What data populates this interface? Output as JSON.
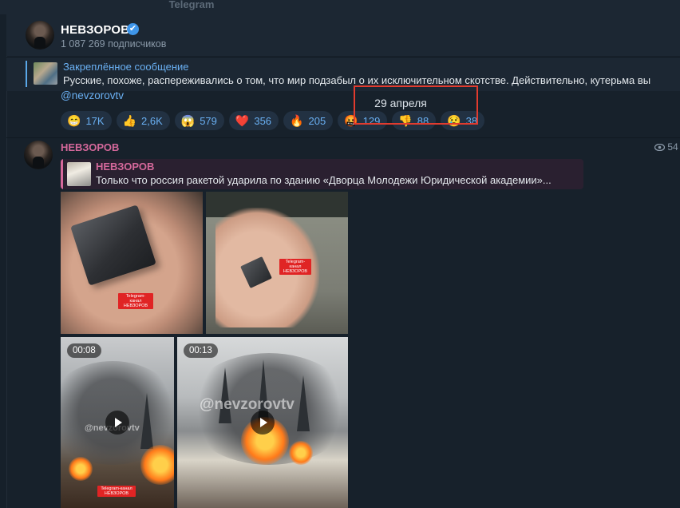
{
  "window": {
    "title": "Telegram"
  },
  "channel": {
    "name": "НЕВЗОРОВ",
    "verified_icon": "verified-check-icon",
    "subscribers": "1 087 269 подписчиков"
  },
  "pinned": {
    "title": "Закреплённое сообщение",
    "text": "Русские, похоже, распереживались о том, что мир подзабыл о их исключительном скотстве.  Действительно, кутерьма вы"
  },
  "prev_message": {
    "link": "@nevzorovtv",
    "reactions": [
      {
        "emoji": "😁",
        "icon": "grin-emoji-icon",
        "count": "17K"
      },
      {
        "emoji": "👍",
        "icon": "thumbs-up-emoji-icon",
        "count": "2,6K"
      },
      {
        "emoji": "😱",
        "icon": "scream-emoji-icon",
        "count": "579"
      },
      {
        "emoji": "❤️",
        "icon": "heart-emoji-icon",
        "count": "356"
      },
      {
        "emoji": "🔥",
        "icon": "fire-emoji-icon",
        "count": "205"
      },
      {
        "emoji": "🤬",
        "icon": "angry-emoji-icon",
        "count": "129"
      },
      {
        "emoji": "👎",
        "icon": "thumbs-down-emoji-icon",
        "count": "88"
      },
      {
        "emoji": "😢",
        "icon": "cry-emoji-icon",
        "count": "38"
      }
    ]
  },
  "date_separator": "29 апреля",
  "message": {
    "author": "НЕВЗОРОВ",
    "views": "54",
    "forwarded": {
      "name": "НЕВЗОРОВ",
      "text": "Только что россия ракетой ударила по зданию «Дворца Молодежи Юридической академии»..."
    },
    "media": [
      {
        "type": "photo",
        "watermark": "Telegram-канал НЕВЗОРОВ"
      },
      {
        "type": "photo",
        "watermark": "Telegram-канал НЕВЗОРОВ"
      },
      {
        "type": "video",
        "duration": "00:08",
        "watermark": "Telegram-канал НЕВЗОРОВ",
        "overlay": "@nevzorovtv"
      },
      {
        "type": "video",
        "duration": "00:13",
        "overlay": "@nevzorovtv"
      }
    ]
  },
  "colors": {
    "background": "#17212b",
    "accent_link": "#6ab0f3",
    "author": "#d5689b",
    "highlight_box": "#e23b2e"
  }
}
